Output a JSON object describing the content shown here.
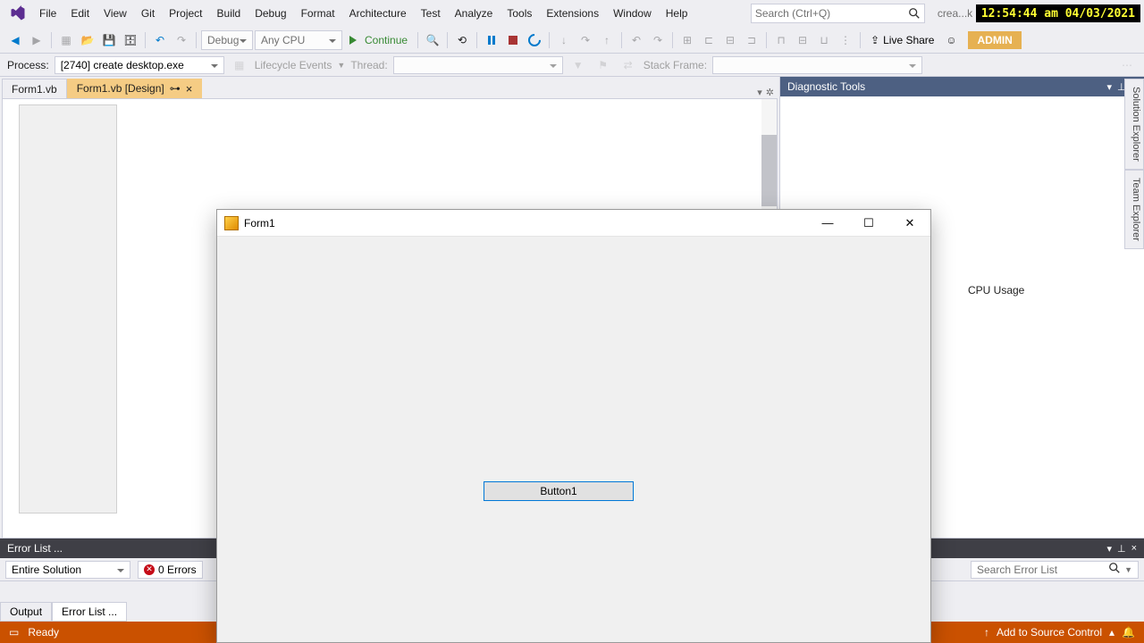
{
  "clock": "12:54:44 am 04/03/2021",
  "menu": [
    "File",
    "Edit",
    "View",
    "Git",
    "Project",
    "Build",
    "Debug",
    "Format",
    "Architecture",
    "Test",
    "Analyze",
    "Tools",
    "Extensions",
    "Window",
    "Help"
  ],
  "search_placeholder": "Search (Ctrl+Q)",
  "solution_short": "crea...kt",
  "toolbar": {
    "config": "Debug",
    "platform": "Any CPU",
    "continue": "Continue",
    "live_share": "Live Share",
    "admin": "ADMIN"
  },
  "process": {
    "label": "Process:",
    "value": "[2740] create desktop.exe",
    "lifecycle": "Lifecycle Events",
    "thread_label": "Thread:",
    "stack_label": "Stack Frame:"
  },
  "tabs": {
    "inactive": "Form1.vb",
    "active": "Form1.vb [Design]"
  },
  "diag": {
    "title": "Diagnostic Tools",
    "cpu": "CPU Usage"
  },
  "side_tabs": [
    "Solution Explorer",
    "Team Explorer"
  ],
  "errorlist": {
    "title": "Error List ...",
    "scope": "Entire Solution",
    "errors": "0 Errors",
    "search_placeholder": "Search Error List",
    "tab_output": "Output",
    "tab_errorlist": "Error List ..."
  },
  "status": {
    "ready": "Ready",
    "add_source": "Add to Source Control"
  },
  "form1": {
    "title": "Form1",
    "button": "Button1"
  }
}
